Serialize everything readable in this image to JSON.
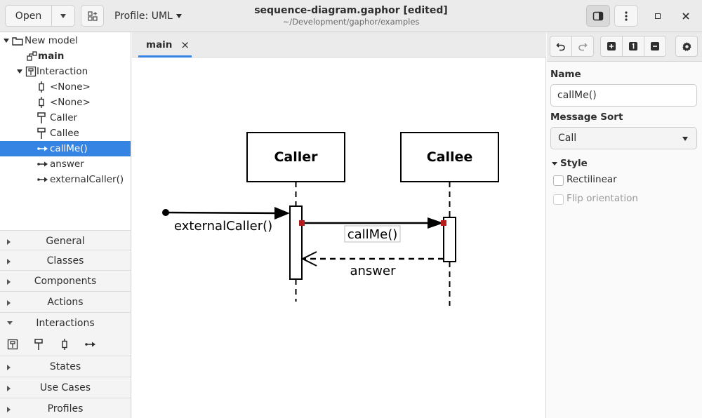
{
  "header": {
    "open_label": "Open",
    "profile_label": "Profile: UML",
    "title": "sequence-diagram.gaphor [edited]",
    "subtitle": "~/Development/gaphor/examples"
  },
  "tree": {
    "items": [
      {
        "label": "New model"
      },
      {
        "label": "main"
      },
      {
        "label": "Interaction"
      },
      {
        "label": "<None>"
      },
      {
        "label": "<None>"
      },
      {
        "label": "Caller"
      },
      {
        "label": "Callee"
      },
      {
        "label": "callMe()"
      },
      {
        "label": "answer"
      },
      {
        "label": "externalCaller()"
      }
    ]
  },
  "toolbox": {
    "sections": [
      {
        "label": "General"
      },
      {
        "label": "Classes"
      },
      {
        "label": "Components"
      },
      {
        "label": "Actions"
      },
      {
        "label": "Interactions"
      },
      {
        "label": "States"
      },
      {
        "label": "Use Cases"
      },
      {
        "label": "Profiles"
      }
    ]
  },
  "tabs": [
    {
      "label": "main",
      "close": "×"
    }
  ],
  "diagram": {
    "lifelines": [
      {
        "name": "Caller"
      },
      {
        "name": "Callee"
      }
    ],
    "messages": [
      {
        "label": "externalCaller()"
      },
      {
        "label": "callMe()"
      },
      {
        "label": "answer"
      }
    ]
  },
  "editor": {
    "name_label": "Name",
    "name_value": "callMe()",
    "sort_label": "Message Sort",
    "sort_value": "Call",
    "style_label": "Style",
    "rectilinear_label": "Rectilinear",
    "flip_label": "Flip orientation"
  },
  "colors": {
    "accent": "#3584e4",
    "selection_handle": "#b71c1c"
  }
}
